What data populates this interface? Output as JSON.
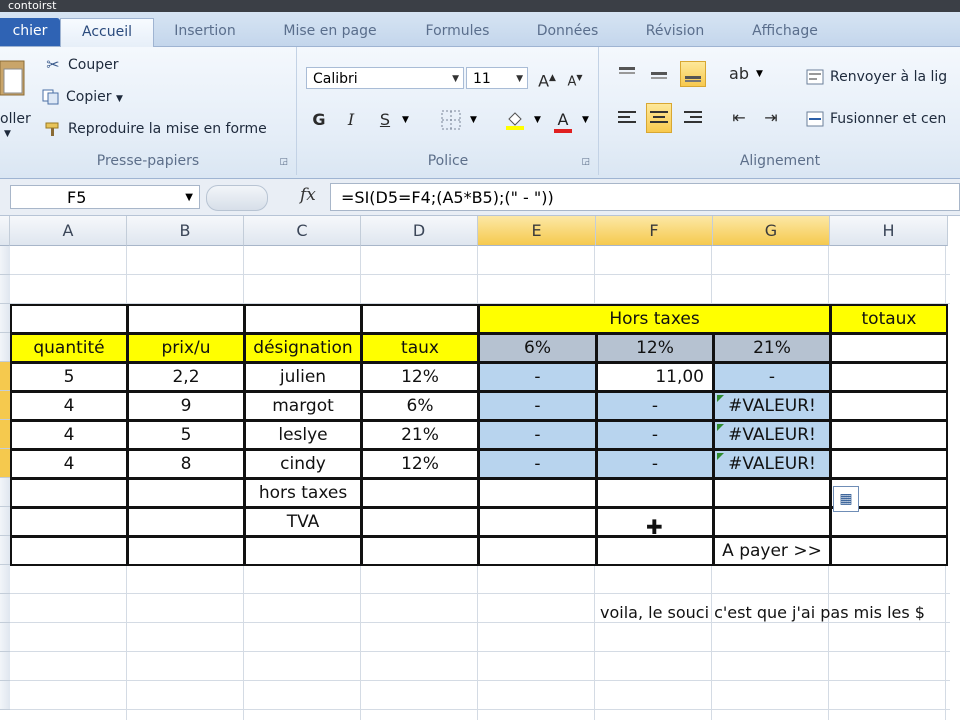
{
  "window": {
    "title": "contoirst"
  },
  "tabs": [
    {
      "label": "chier"
    },
    {
      "label": "Accueil"
    },
    {
      "label": "Insertion"
    },
    {
      "label": "Mise en page"
    },
    {
      "label": "Formules"
    },
    {
      "label": "Données"
    },
    {
      "label": "Révision"
    },
    {
      "label": "Affichage"
    }
  ],
  "ribbon": {
    "clipboard": {
      "paste": "oller",
      "cut": "Couper",
      "copy": "Copier",
      "format_painter": "Reproduire la mise en forme",
      "group": "Presse-papiers"
    },
    "font": {
      "name": "Calibri",
      "size": "11",
      "bold": "G",
      "italic": "I",
      "underline": "S",
      "group": "Police"
    },
    "alignment": {
      "wrap": "Renvoyer à la lig",
      "merge": "Fusionner et cen",
      "group": "Alignement"
    }
  },
  "formula_bar": {
    "cell_ref": "F5",
    "fx": "fx",
    "formula": "=SI(D5=F4;(A5*B5);(\" - \"))"
  },
  "columns": [
    "A",
    "B",
    "C",
    "D",
    "E",
    "F",
    "G",
    "H"
  ],
  "sheet": {
    "hors_taxes_header": "Hors taxes",
    "totaux_header": "totaux",
    "headers": {
      "quantite": "quantité",
      "prix": "prix/u",
      "designation": "désignation",
      "taux": "taux",
      "e": "6%",
      "f": "12%",
      "g": "21%"
    },
    "rows": [
      {
        "a": "5",
        "b": "2,2",
        "c": "julien",
        "d": "12%",
        "e": "-",
        "f": "11,00",
        "g": "-"
      },
      {
        "a": "4",
        "b": "9",
        "c": "margot",
        "d": "6%",
        "e": "-",
        "f": "-",
        "g": "#VALEUR!"
      },
      {
        "a": "4",
        "b": "5",
        "c": "leslye",
        "d": "21%",
        "e": "-",
        "f": "-",
        "g": "#VALEUR!"
      },
      {
        "a": "4",
        "b": "8",
        "c": "cindy",
        "d": "12%",
        "e": "-",
        "f": "-",
        "g": "#VALEUR!"
      }
    ],
    "hors_taxes_label": "hors taxes",
    "tva_label": "TVA",
    "a_payer_label": "A payer >>",
    "note": "voila, le souci c'est que j'ai pas mis les $"
  },
  "colors": {
    "yellow": "#ffff00",
    "blue_selection": "#b8d4ee",
    "ribbon_tab": "#2f63b4"
  }
}
